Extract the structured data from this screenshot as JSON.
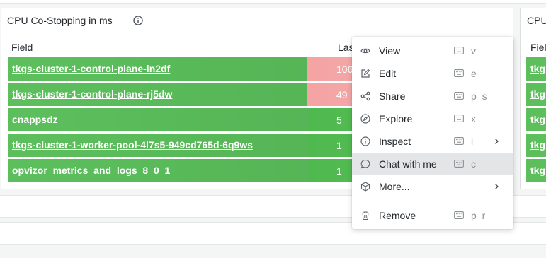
{
  "panel": {
    "title": "CPU Co-Stopping in ms",
    "columns": {
      "field": "Field",
      "last": "Last"
    },
    "rows": [
      {
        "name": "tkgs-cluster-1-control-plane-ln2df",
        "value": "106",
        "status": "high"
      },
      {
        "name": "tkgs-cluster-1-control-plane-rj5dw",
        "value": "49",
        "status": "high"
      },
      {
        "name": "cnappsdz",
        "value": "5",
        "status": "normal"
      },
      {
        "name": "tkgs-cluster-1-worker-pool-4l7s5-949cd765d-6q9ws",
        "value": "1",
        "status": "normal"
      },
      {
        "name": "opvizor_metrics_and_logs_8_0_1",
        "value": "1",
        "status": "normal"
      }
    ]
  },
  "right_panel": {
    "title": "CPU",
    "column_field": "Field",
    "rows": [
      "tkg",
      "tkg",
      "tkg",
      "tkg",
      "tkg"
    ]
  },
  "menu": {
    "items": [
      {
        "label": "View",
        "shortcut": "v",
        "icon": "eye-icon"
      },
      {
        "label": "Edit",
        "shortcut": "e",
        "icon": "edit-icon"
      },
      {
        "label": "Share",
        "shortcut": "p s",
        "icon": "share-icon"
      },
      {
        "label": "Explore",
        "shortcut": "x",
        "icon": "compass-icon"
      },
      {
        "label": "Inspect",
        "shortcut": "i",
        "icon": "info-icon",
        "submenu": true
      },
      {
        "label": "Chat with me",
        "shortcut": "c",
        "icon": "chat-icon",
        "active": true
      },
      {
        "label": "More...",
        "shortcut": "",
        "icon": "cube-icon",
        "submenu": true
      },
      {
        "label": "Remove",
        "shortcut": "p r",
        "icon": "trash-icon"
      }
    ]
  },
  "colors": {
    "green_cell": "#5cbf5c",
    "red_cell": "#f5a3a3",
    "menu_active": "#e4e5e6",
    "muted_text": "#8e9296"
  }
}
